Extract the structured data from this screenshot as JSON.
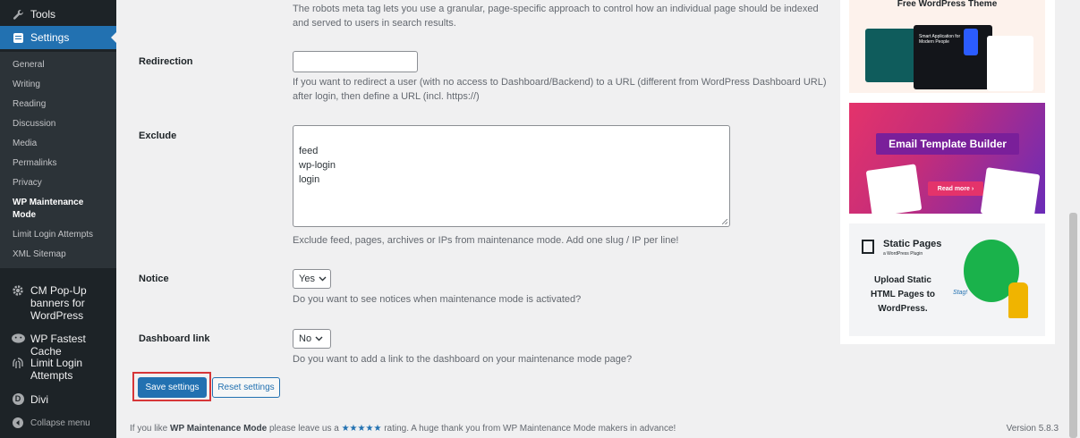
{
  "sidebar": {
    "tools_label": "Tools",
    "settings_label": "Settings",
    "submenu": [
      "General",
      "Writing",
      "Reading",
      "Discussion",
      "Media",
      "Permalinks",
      "Privacy",
      "WP Maintenance Mode",
      "Limit Login Attempts",
      "XML Sitemap"
    ],
    "plugins": [
      {
        "label": "CM Pop-Up banners for WordPress",
        "icon": "gear-icon"
      },
      {
        "label": "WP Fastest Cache",
        "icon": "cheetah-icon"
      },
      {
        "label": "Limit Login Attempts",
        "icon": "fingerprint-icon"
      },
      {
        "label": "Divi",
        "icon": "divi-icon"
      }
    ],
    "collapse_label": "Collapse menu"
  },
  "main": {
    "robots_description": "The robots meta tag lets you use a granular, page-specific approach to control how an individual page should be indexed and served to users in search results.",
    "redirection": {
      "label": "Redirection",
      "value": "",
      "description": "If you want to redirect a user (with no access to Dashboard/Backend) to a URL (different from WordPress Dashboard URL) after login, then define a URL (incl. https://)"
    },
    "exclude": {
      "label": "Exclude",
      "value": "feed\nwp-login\nlogin",
      "description": "Exclude feed, pages, archives or IPs from maintenance mode. Add one slug / IP per line!"
    },
    "notice": {
      "label": "Notice",
      "value": "Yes",
      "description": "Do you want to see notices when maintenance mode is activated?"
    },
    "dashboard_link": {
      "label": "Dashboard link",
      "value": "No",
      "description": "Do you want to add a link to the dashboard on your maintenance mode page?"
    },
    "save_label": "Save settings",
    "reset_label": "Reset settings"
  },
  "footer": {
    "prefix": "If you like ",
    "plugin_name": "WP Maintenance Mode",
    "middle": " please leave us a ",
    "stars": "★★★★★",
    "suffix": " rating. A huge thank you from WP Maintenance Mode makers in advance!",
    "version": "Version 5.8.3"
  },
  "ads": {
    "theme_title": "Free WordPress Theme",
    "theme_card_text": "Smart Application for Modern People",
    "email_title": "Email Template Builder",
    "email_cta": "Read more ›",
    "static_brand": "Static Pages",
    "static_sub": "a WordPress Plugin",
    "static_text": "Upload Static HTML Pages to WordPress.",
    "static_scribble": "Stag!"
  },
  "colors": {
    "accent": "#2271b1",
    "sidebar_bg": "#1d2327",
    "highlight": "#d63638"
  }
}
